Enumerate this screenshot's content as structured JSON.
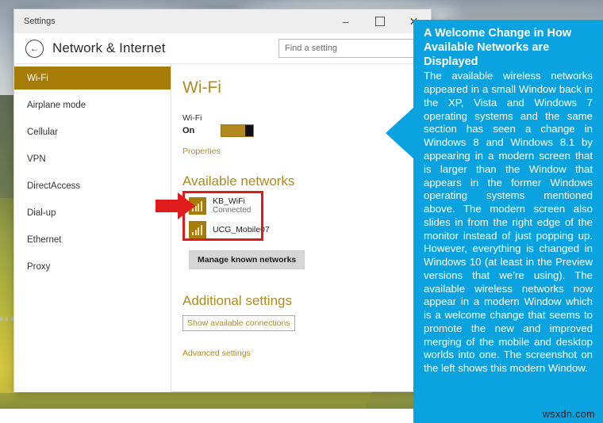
{
  "window": {
    "title": "Settings",
    "minimize_label": "–",
    "maximize_label": "",
    "close_label": "✕",
    "back_label": "←",
    "page_title": "Network & Internet",
    "search_placeholder": "Find a setting",
    "search_value": ""
  },
  "sidebar": {
    "items": [
      {
        "label": "Wi-Fi",
        "selected": true
      },
      {
        "label": "Airplane mode",
        "selected": false
      },
      {
        "label": "Cellular",
        "selected": false
      },
      {
        "label": "VPN",
        "selected": false
      },
      {
        "label": "DirectAccess",
        "selected": false
      },
      {
        "label": "Dial-up",
        "selected": false
      },
      {
        "label": "Ethernet",
        "selected": false
      },
      {
        "label": "Proxy",
        "selected": false
      }
    ]
  },
  "content": {
    "heading": "Wi-Fi",
    "wifi_label": "Wi-Fi",
    "wifi_state": "On",
    "properties_link": "Properties",
    "available_networks_heading": "Available networks",
    "networks": [
      {
        "name": "KB_WiFi",
        "status": "Connected"
      },
      {
        "name": "UCG_Mobile07",
        "status": ""
      }
    ],
    "manage_button": "Manage known networks",
    "additional_settings_heading": "Additional settings",
    "show_connections_button": "Show available connections",
    "advanced_settings_link": "Advanced settings"
  },
  "callout": {
    "heading": "A Welcome Change in How Available Networks are Displayed",
    "body": "The available wireless networks appeared in a small Window back in the XP, Vista and Windows 7 operating systems and the same section has seen a change in Windows 8 and Windows 8.1 by appearing in a modern screen that is larger than the Window that appears in the former Windows operating systems mentioned above. The modern screen also slides in from the right edge of the monitor instead of just popping up. However, everything is changed in Windows 10 (at least in the Preview versions that we’re using). The available wireless networks now appear in a modern Window which is a welcome change that seems to promote the new and improved merging of the mobile and desktop worlds into one. The screenshot on the left shows this modern Window.",
    "watermark": "wsxdn.com"
  },
  "colors": {
    "accent_gold": "#b08a1e",
    "sidebar_selected": "#a67c08",
    "callout_blue": "#0aa3e0",
    "highlight_red": "#e01b1b"
  }
}
